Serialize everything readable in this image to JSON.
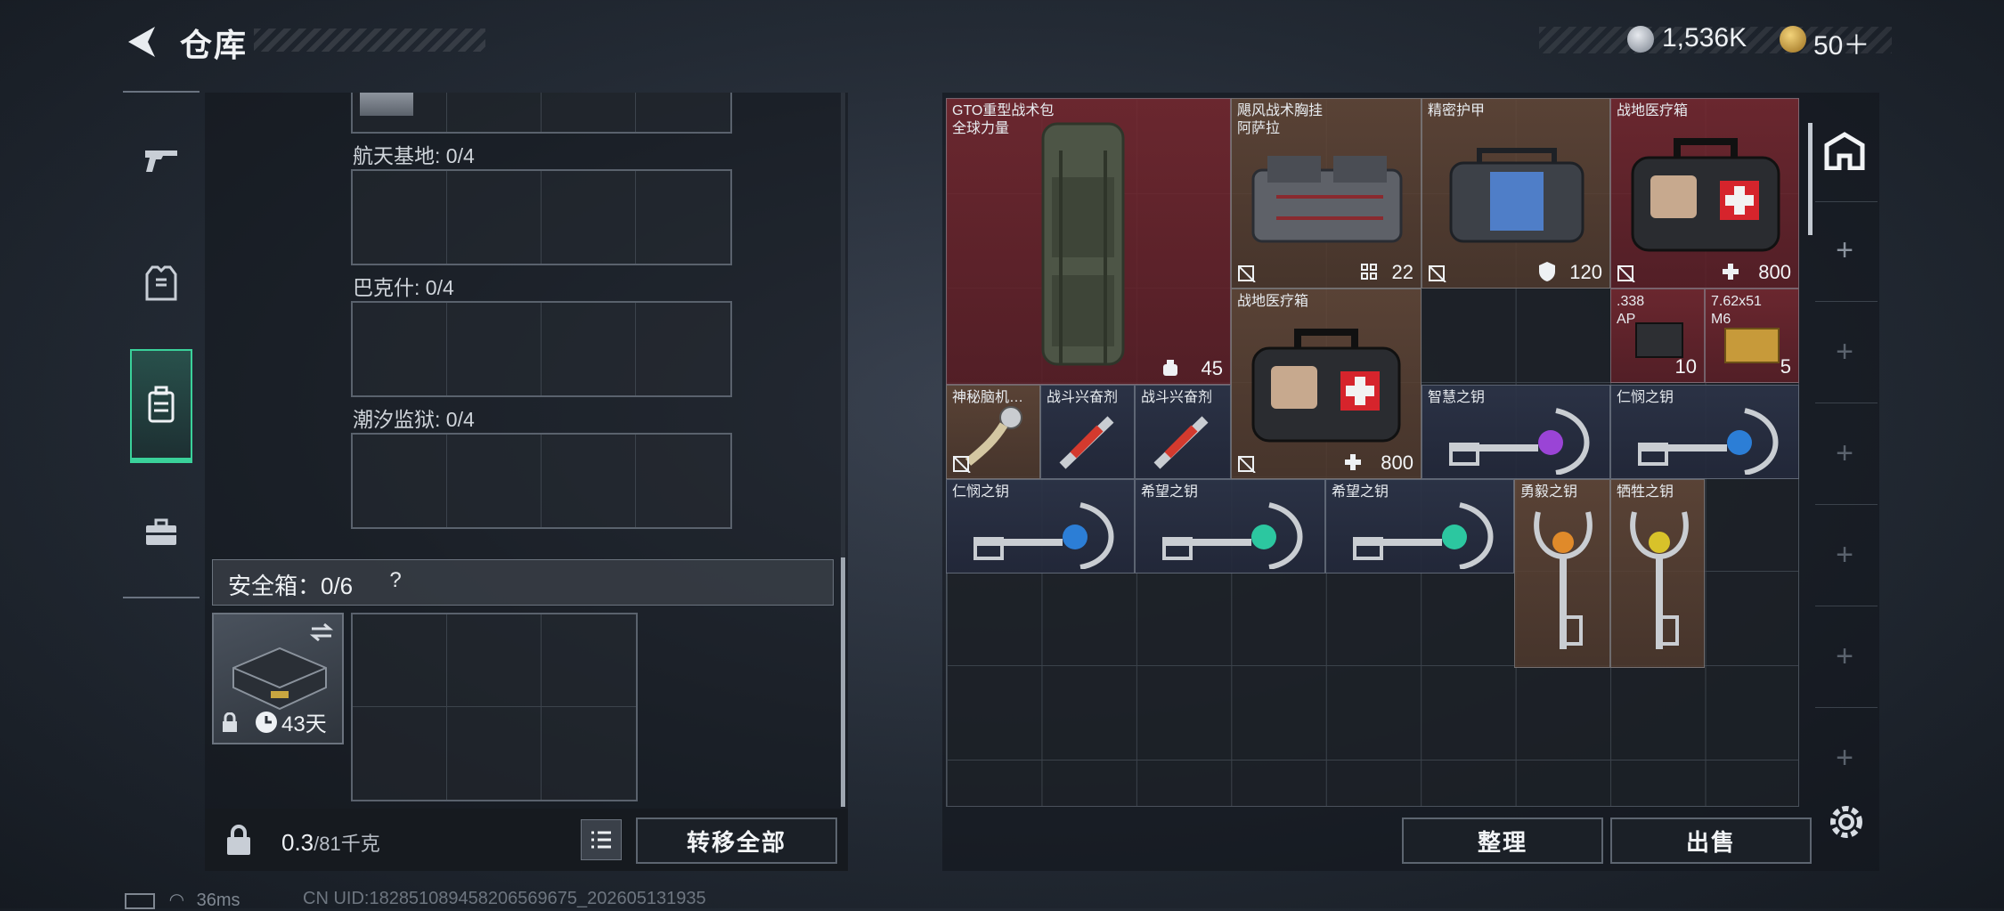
{
  "header": {
    "title": "仓库"
  },
  "currency": {
    "silver": "1,536K",
    "gold": "50＋"
  },
  "maps": [
    {
      "label": "航天基地: 0/4"
    },
    {
      "label": "巴克什: 0/4"
    },
    {
      "label": "潮汐监狱: 0/4"
    }
  ],
  "safe_box": {
    "label": "安全箱：0/6",
    "help": "?",
    "days": "43天"
  },
  "footer": {
    "weight_value": "0.3",
    "weight_unit": "/81千克",
    "transfer_all": "转移全部",
    "organize": "整理",
    "sell": "出售"
  },
  "inventory": {
    "items": [
      {
        "name": "GTO重型战术包\n全球力量",
        "value": "45",
        "tint": "red"
      },
      {
        "name": "飓风战术胸挂\n阿萨拉",
        "value": "22",
        "tint": "brown"
      },
      {
        "name": "精密护甲",
        "value": "120",
        "tint": "brown"
      },
      {
        "name": "战地医疗箱",
        "value": "800",
        "tint": "red"
      },
      {
        "name": "战地医疗箱",
        "value": "800",
        "tint": "brown"
      },
      {
        "name": ".338\nAP",
        "value": "10",
        "tint": "red"
      },
      {
        "name": "7.62x51\nM6",
        "value": "5",
        "tint": "red"
      },
      {
        "name": "神秘脑机…",
        "value": "",
        "tint": "brown"
      },
      {
        "name": "战斗兴奋剂",
        "value": "",
        "tint": "blue"
      },
      {
        "name": "战斗兴奋剂",
        "value": "",
        "tint": "blue"
      },
      {
        "name": "智慧之钥",
        "value": "",
        "tint": "blue"
      },
      {
        "name": "仁悯之钥",
        "value": "",
        "tint": "blue"
      },
      {
        "name": "仁悯之钥",
        "value": "",
        "tint": "blue"
      },
      {
        "name": "希望之钥",
        "value": "",
        "tint": "blue"
      },
      {
        "name": "希望之钥",
        "value": "",
        "tint": "blue"
      },
      {
        "name": "勇毅之钥",
        "value": "",
        "tint": "brown"
      },
      {
        "name": "牺牲之钥",
        "value": "",
        "tint": "brown"
      }
    ]
  },
  "status_bar": {
    "ping": "36ms",
    "uid": "CN UID:18285108945820656​9675_202605131935"
  },
  "colors": {
    "accent": "#3ad19a",
    "red_tint": "#7a2830",
    "brown_tint": "#644838",
    "blue_tint": "#2c3448"
  },
  "icons": [
    "back-icon",
    "silver-coin-icon",
    "gold-coin-icon",
    "pistol-icon",
    "armor-icon",
    "backpack-icon",
    "briefcase-icon",
    "lock-icon",
    "clock-icon",
    "swap-icon",
    "list-icon",
    "home-icon",
    "plus-icon",
    "gear-icon",
    "no-trade-icon"
  ]
}
